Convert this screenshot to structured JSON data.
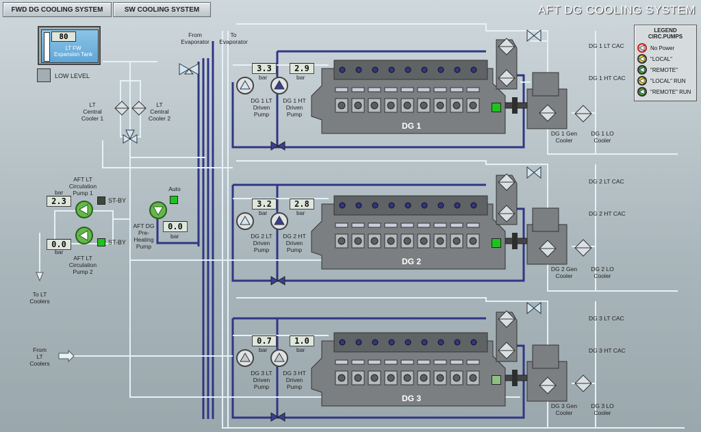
{
  "nav": {
    "fwd_label": "FWD DG COOLING SYSTEM",
    "sw_label": "SW  COOLING SYSTEM"
  },
  "title": "AFT DG COOLING SYSTEM",
  "expansion_tank": {
    "value": "80",
    "name": "LT FW\nExpansion Tank",
    "low_level_label": "LOW LEVEL"
  },
  "coolers": {
    "central1": "LT\nCentral\nCooler 1",
    "central2": "LT\nCentral\nCooler 2"
  },
  "evap": {
    "from": "From\nEvaporator",
    "to": "To\nEvaporator"
  },
  "circ_pumps": {
    "pump1": {
      "label": "AFT LT\nCirculation\nPump 1",
      "pressure": "2.3",
      "unit": "bar",
      "mode": "ST-BY"
    },
    "pump2": {
      "label": "AFT LT\nCirculation\nPump 2",
      "pressure": "0.0",
      "unit": "bar",
      "mode": "ST-BY"
    }
  },
  "preheat": {
    "label": "AFT DG\nPre-\nHeating\nPump",
    "auto_label": "Auto",
    "pressure": "0.0",
    "unit": "bar"
  },
  "to_lt_coolers": "To LT\nCoolers",
  "from_lt_coolers": "From\nLT\nCoolers",
  "engines": [
    {
      "name": "DG 1",
      "lt_pressure": "3.3",
      "ht_pressure": "2.9",
      "unit": "bar",
      "lt_pump": "DG 1 LT\nDriven\nPump",
      "ht_pump": "DG 1 HT\nDriven\nPump",
      "lt_cac": "DG 1 LT CAC",
      "ht_cac": "DG 1 HT CAC",
      "gen_cooler": "DG 1 Gen\nCooler",
      "lo_cooler": "DG 1 LO\nCooler"
    },
    {
      "name": "DG 2",
      "lt_pressure": "3.2",
      "ht_pressure": "2.8",
      "unit": "bar",
      "lt_pump": "DG 2 LT\nDriven\nPump",
      "ht_pump": "DG 2 HT\nDriven\nPump",
      "lt_cac": "DG 2 LT CAC",
      "ht_cac": "DG 2 HT CAC",
      "gen_cooler": "DG 2 Gen\nCooler",
      "lo_cooler": "DG 2 LO\nCooler"
    },
    {
      "name": "DG 3",
      "lt_pressure": "0.7",
      "ht_pressure": "1.0",
      "unit": "bar",
      "lt_pump": "DG 3 LT\nDriven\nPump",
      "ht_pump": "DG 3 HT\nDriven\nPump",
      "lt_cac": "DG 3 LT CAC",
      "ht_cac": "DG 3 HT CAC",
      "gen_cooler": "DG 3 Gen\nCooler",
      "lo_cooler": "DG 3 LO\nCooler"
    }
  ],
  "legend": {
    "title": "LEGEND\nCIRC.PUMPS",
    "items": [
      {
        "label": "No Power",
        "fill": "#d8dcdd",
        "ring": "#d62020"
      },
      {
        "label": "\"LOCAL\"",
        "fill": "#e8d43a",
        "ring": "#333333"
      },
      {
        "label": "\"REMOTE\"",
        "fill": "#4aa84a",
        "ring": "#333333"
      },
      {
        "label": "\"LOCAL\" RUN",
        "fill": "#e8d43a",
        "ring": "#333333"
      },
      {
        "label": "\"REMOTE\" RUN",
        "fill": "#4aa84a",
        "ring": "#333333"
      }
    ]
  },
  "colors": {
    "lt_pipe": "#e8f4fb",
    "ht_pipe": "#3a3f8f",
    "running": "#1ec31e"
  }
}
